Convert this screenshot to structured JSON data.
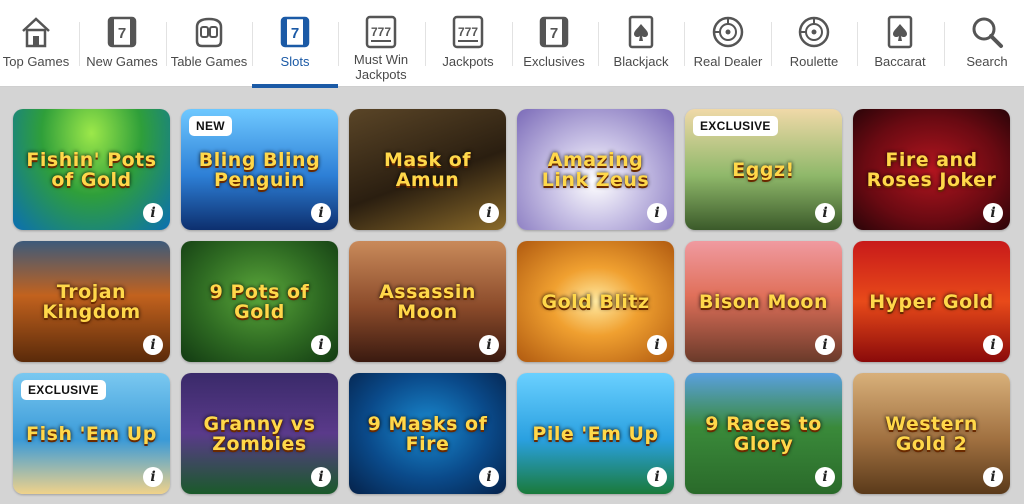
{
  "nav": {
    "items": [
      {
        "label": "Top Games",
        "icon": "home-icon"
      },
      {
        "label": "New Games",
        "icon": "slot-seven-icon"
      },
      {
        "label": "Table Games",
        "icon": "slot-machine-icon"
      },
      {
        "label": "Slots",
        "icon": "slot-seven-icon"
      },
      {
        "label": "Must Win Jackpots",
        "icon": "triple-seven-icon"
      },
      {
        "label": "Jackpots",
        "icon": "triple-seven-icon"
      },
      {
        "label": "Exclusives",
        "icon": "slot-seven-icon"
      },
      {
        "label": "Blackjack",
        "icon": "playing-card-icon"
      },
      {
        "label": "Real Dealer",
        "icon": "roulette-wheel-icon"
      },
      {
        "label": "Roulette",
        "icon": "roulette-wheel-icon"
      },
      {
        "label": "Baccarat",
        "icon": "playing-card-icon"
      },
      {
        "label": "Search",
        "icon": "search-icon"
      }
    ],
    "active": "Slots",
    "accent": "#1b5aa6"
  },
  "games": [
    {
      "title": "Fishin' Pots of Gold",
      "badge": ""
    },
    {
      "title": "Bling Bling Penguin",
      "badge": "NEW"
    },
    {
      "title": "Mask of Amun",
      "badge": ""
    },
    {
      "title": "Amazing Link Zeus",
      "badge": ""
    },
    {
      "title": "Eggz!",
      "badge": "EXCLUSIVE"
    },
    {
      "title": "Fire and Roses Joker",
      "badge": ""
    },
    {
      "title": "Trojan Kingdom",
      "badge": ""
    },
    {
      "title": "9 Pots of Gold",
      "badge": ""
    },
    {
      "title": "Assassin Moon",
      "badge": ""
    },
    {
      "title": "Gold Blitz",
      "badge": ""
    },
    {
      "title": "Bison Moon",
      "badge": ""
    },
    {
      "title": "Hyper Gold",
      "badge": ""
    },
    {
      "title": "Fish 'Em Up",
      "badge": "EXCLUSIVE"
    },
    {
      "title": "Granny vs Zombies",
      "badge": ""
    },
    {
      "title": "9 Masks of Fire",
      "badge": ""
    },
    {
      "title": "Pile 'Em Up",
      "badge": ""
    },
    {
      "title": "9 Races to Glory",
      "badge": ""
    },
    {
      "title": "Western Gold 2",
      "badge": ""
    }
  ],
  "info_icon": "i"
}
